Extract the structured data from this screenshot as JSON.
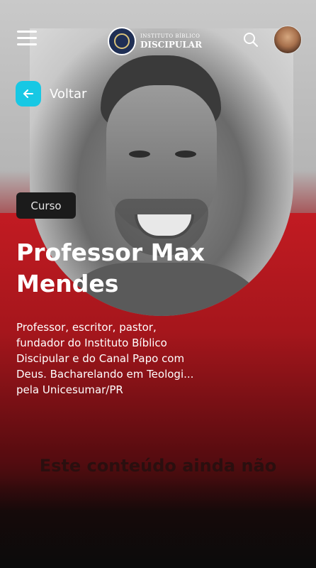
{
  "header": {
    "logo_line1": "INSTITUTO BÍBLICO",
    "logo_line2": "DISCIPULAR",
    "menu_icon": "hamburger-menu-icon",
    "search_icon": "search-icon"
  },
  "back": {
    "label": "Voltar",
    "icon": "arrow-left-icon"
  },
  "course": {
    "badge": "Curso",
    "title": "Professor Max Mendes",
    "description": "Professor, escritor, pastor, fundador do Instituto Bíblico Discipular e do Canal Papo com Deus. Bacharelando em Teologi... pela Unicesumar/PR"
  },
  "notice": "Este conteúdo ainda não",
  "colors": {
    "accent": "#17c8e4",
    "brand_red": "#c21b22",
    "badge_bg": "#1b1b1b"
  }
}
